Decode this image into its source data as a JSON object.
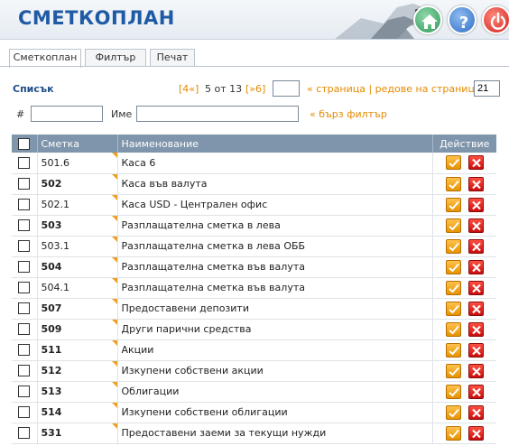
{
  "app": {
    "title": "СМЕТКОПЛАН"
  },
  "header_buttons": [
    {
      "name": "home-icon"
    },
    {
      "name": "help-icon"
    },
    {
      "name": "power-icon"
    }
  ],
  "tabs": [
    {
      "label": "Сметкоплан",
      "active": true
    },
    {
      "label": "Филтър",
      "active": false
    },
    {
      "label": "Печат",
      "active": false
    }
  ],
  "list": {
    "label": "Списък",
    "first": "[4«]",
    "page_info": "5 от 13",
    "last": "[»6]",
    "page_value": "",
    "page_link": "« страница | редове на страница »",
    "rows_value": "21"
  },
  "filter": {
    "hash_label": "#",
    "hash_value": "",
    "name_label": "Име",
    "name_value": "",
    "quick_filter": "« бърз филтър"
  },
  "table": {
    "headers": {
      "code": "Сметка",
      "name": "Наименование",
      "action": "Действие"
    },
    "rows": [
      {
        "code": "501.6",
        "name": "Каса 6",
        "bold": false
      },
      {
        "code": "502",
        "name": "Каса във валута",
        "bold": true
      },
      {
        "code": "502.1",
        "name": "Каса USD - Централен офис",
        "bold": false
      },
      {
        "code": "503",
        "name": "Разплащателна сметка в лева",
        "bold": true
      },
      {
        "code": "503.1",
        "name": "Разплащателна сметка в лева ОББ",
        "bold": false
      },
      {
        "code": "504",
        "name": "Разплащателна сметка във валута",
        "bold": true
      },
      {
        "code": "504.1",
        "name": "Разплащателна сметка във валута",
        "bold": false
      },
      {
        "code": "507",
        "name": "Предоставени депозити",
        "bold": true
      },
      {
        "code": "509",
        "name": "Други парични средства",
        "bold": true
      },
      {
        "code": "511",
        "name": "Акции",
        "bold": true
      },
      {
        "code": "512",
        "name": "Изкупени собствени акции",
        "bold": true
      },
      {
        "code": "513",
        "name": "Облигации",
        "bold": true
      },
      {
        "code": "514",
        "name": "Изкупени собствени облигации",
        "bold": true
      },
      {
        "code": "531",
        "name": "Предоставени заеми за текущи нужди",
        "bold": true
      }
    ]
  },
  "colors": {
    "brand": "#1f5aa5",
    "header_row": "#7e95ab",
    "link_orange": "#e58a00",
    "edit_button": "#f0a020",
    "delete_button": "#d01f1f"
  }
}
